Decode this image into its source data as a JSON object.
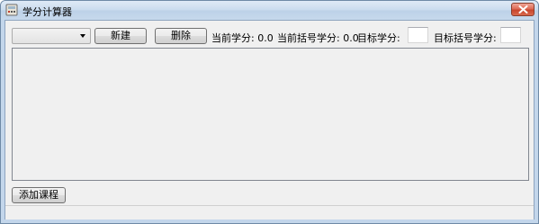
{
  "window": {
    "title": "学分计算器",
    "icons": {
      "app": "calculator-app-icon",
      "close": "close-icon"
    }
  },
  "toolbar": {
    "combo_value": "",
    "new_label": "新建",
    "delete_label": "删除",
    "current_credits_label": "当前学分: 0.0",
    "current_bracket_credits_label": "当前括号学分: 0.0",
    "target_credits_label": "目标学分:",
    "target_credits_value": "",
    "target_bracket_credits_label": "目标括号学分:",
    "target_bracket_credits_value": ""
  },
  "footer": {
    "add_course_label": "添加课程"
  },
  "colors": {
    "client_bg": "#f0f0f0",
    "title_bg": "#c9dbee",
    "close_red": "#c8452c"
  }
}
